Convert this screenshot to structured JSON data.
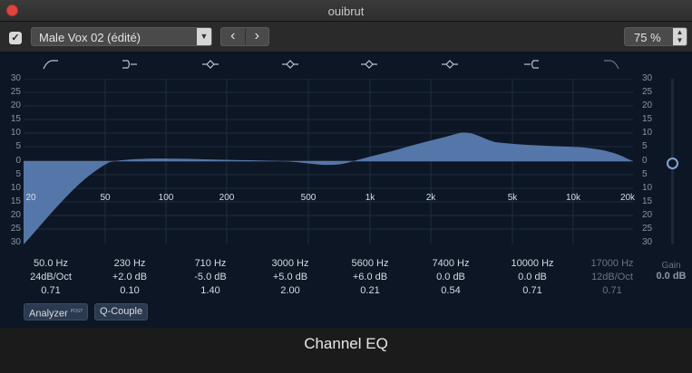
{
  "window": {
    "title": "ouibrut"
  },
  "toolbar": {
    "enabled_check": "✓",
    "preset": "Male Vox 02 (édité)",
    "prev_label": "‹",
    "next_label": "›",
    "zoom": "75 %"
  },
  "graph": {
    "db_ticks": [
      "30",
      "25",
      "20",
      "15",
      "10",
      "5",
      "0",
      "5",
      "10",
      "15",
      "20",
      "25",
      "30"
    ],
    "freq_labels": [
      "20",
      "50",
      "100",
      "200",
      "500",
      "1k",
      "2k",
      "5k",
      "10k",
      "20k"
    ]
  },
  "bands": [
    {
      "freq": "50.0 Hz",
      "gain": "24dB/Oct",
      "q": "0.71",
      "icon": "low-cut-icon",
      "active": true
    },
    {
      "freq": "230 Hz",
      "gain": "+2.0 dB",
      "q": "0.10",
      "icon": "low-shelf-icon",
      "active": true
    },
    {
      "freq": "710 Hz",
      "gain": "-5.0 dB",
      "q": "1.40",
      "icon": "bell-icon",
      "active": true
    },
    {
      "freq": "3000 Hz",
      "gain": "+5.0 dB",
      "q": "2.00",
      "icon": "bell-icon",
      "active": true
    },
    {
      "freq": "5600 Hz",
      "gain": "+6.0 dB",
      "q": "0.21",
      "icon": "bell-icon",
      "active": true
    },
    {
      "freq": "7400 Hz",
      "gain": "0.0 dB",
      "q": "0.54",
      "icon": "bell-icon",
      "active": true
    },
    {
      "freq": "10000 Hz",
      "gain": "0.0 dB",
      "q": "0.71",
      "icon": "high-shelf-icon",
      "active": true
    },
    {
      "freq": "17000 Hz",
      "gain": "12dB/Oct",
      "q": "0.71",
      "icon": "high-cut-icon",
      "active": false
    }
  ],
  "output_gain": {
    "label": "Gain",
    "value": "0.0 dB"
  },
  "buttons": {
    "analyzer": "Analyzer",
    "analyzer_badge": "POST",
    "qcouple": "Q-Couple"
  },
  "footer": {
    "title": "Channel EQ"
  },
  "colors": {
    "curve_fill": "#5b7fb4",
    "grid": "#1f2c40",
    "accent": "#7fa4d4"
  }
}
